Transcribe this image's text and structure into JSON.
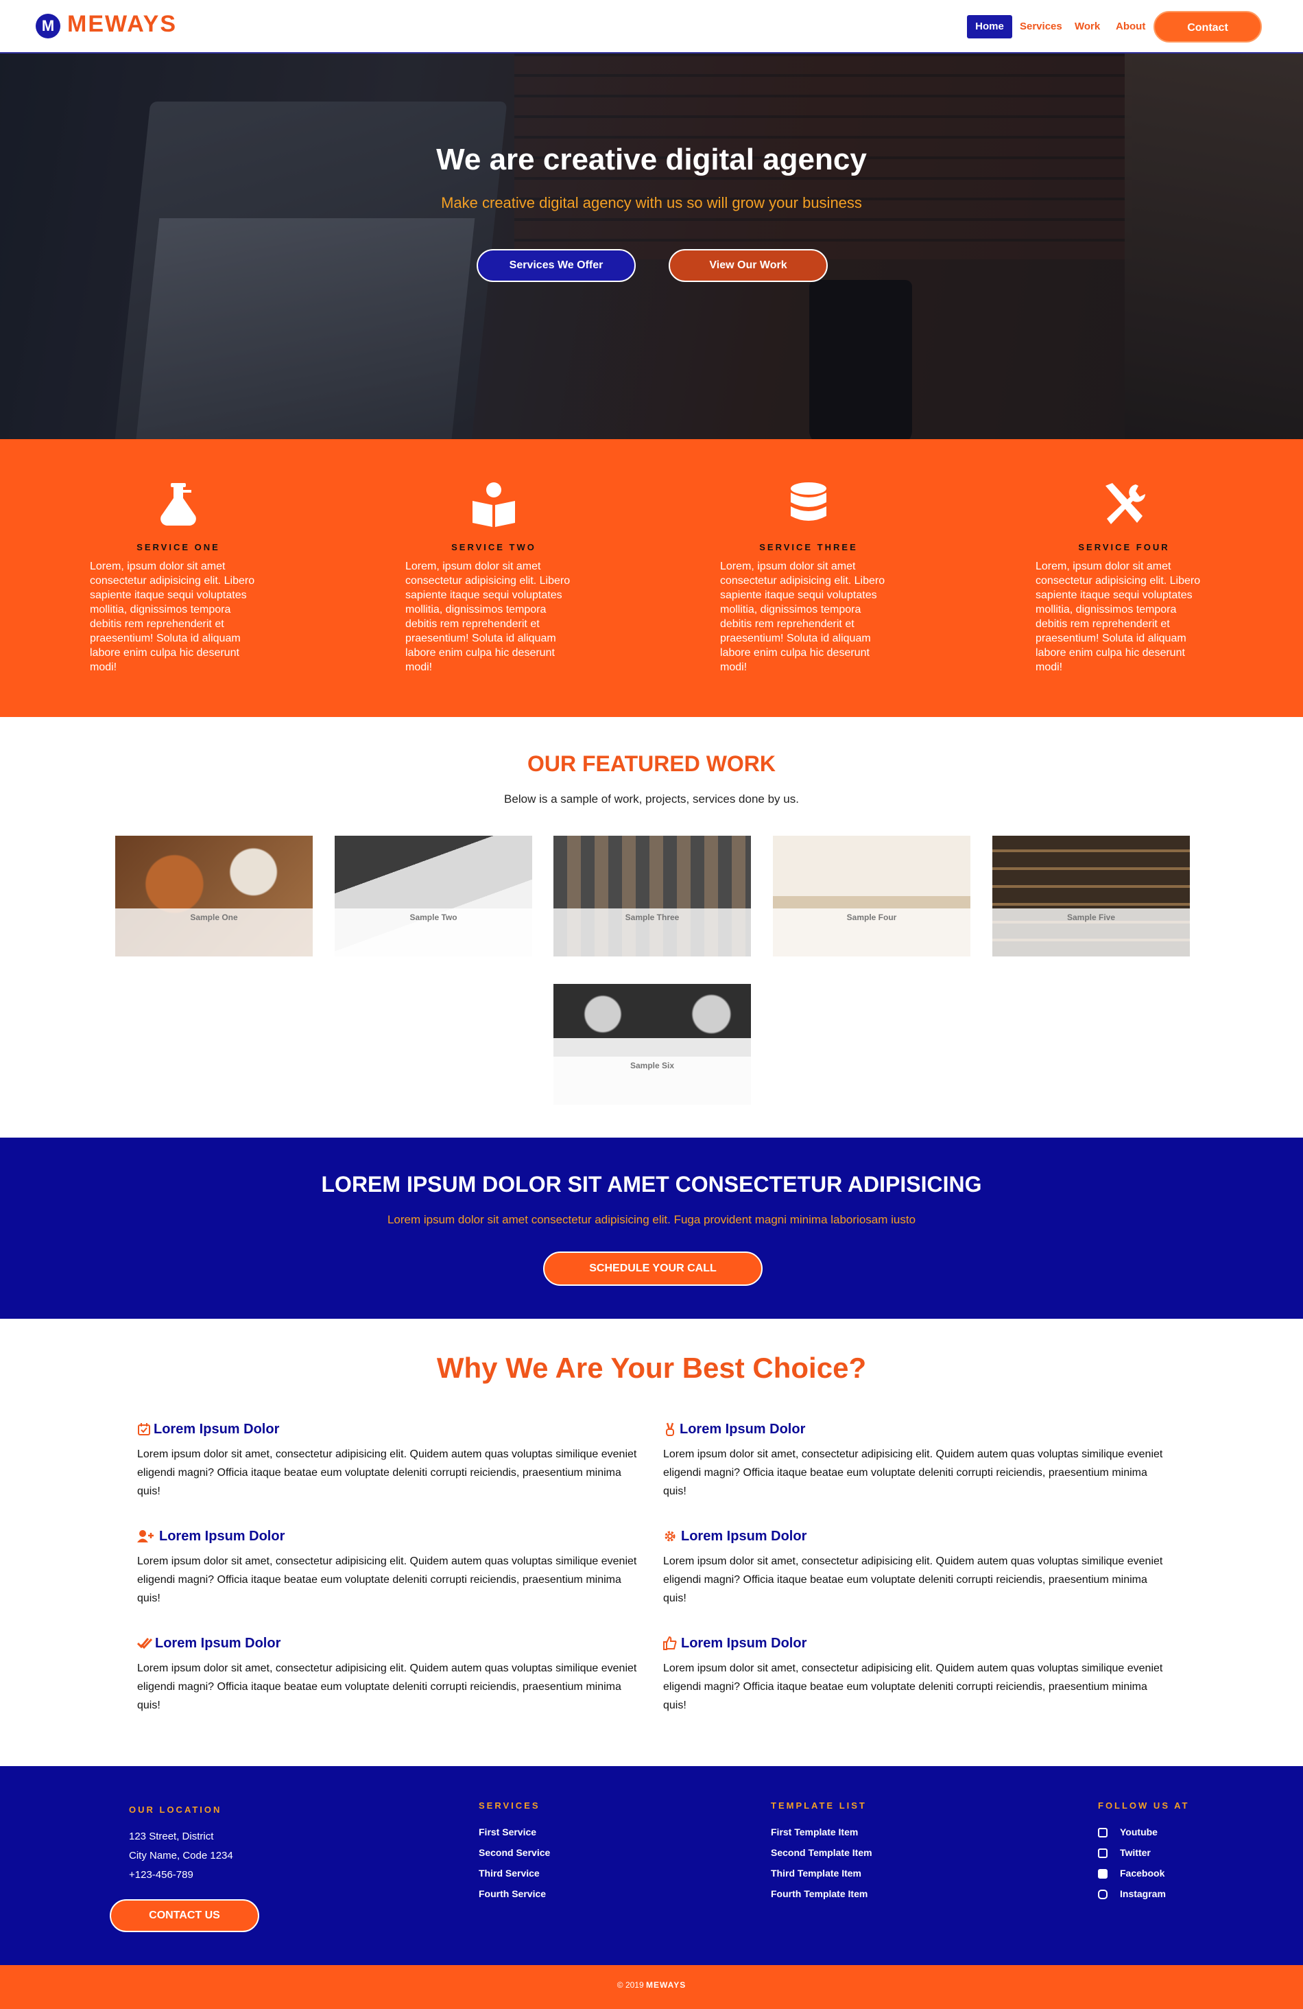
{
  "brand": {
    "name": "MEWAYS",
    "mark": "M"
  },
  "nav": {
    "home": "Home",
    "services": "Services",
    "work": "Work",
    "about": "About",
    "contact": "Contact"
  },
  "hero": {
    "title": "We are creative digital agency",
    "subtitle": "Make creative digital agency with us so will grow your business",
    "btn_services": "Services We Offer",
    "btn_work": "View Our Work"
  },
  "services": [
    {
      "title": "SERVICE ONE",
      "text": "Lorem, ipsum dolor sit amet consectetur adipisicing elit. Libero sapiente itaque sequi voluptates mollitia, dignissimos tempora debitis rem reprehenderit et praesentium! Soluta id aliquam labore enim culpa hic deserunt modi!",
      "icon": "flask-icon"
    },
    {
      "title": "SERVICE TWO",
      "text": "Lorem, ipsum dolor sit amet consectetur adipisicing elit. Libero sapiente itaque sequi voluptates mollitia, dignissimos tempora debitis rem reprehenderit et praesentium! Soluta id aliquam labore enim culpa hic deserunt modi!",
      "icon": "book-reader-icon"
    },
    {
      "title": "SERVICE THREE",
      "text": "Lorem, ipsum dolor sit amet consectetur adipisicing elit. Libero sapiente itaque sequi voluptates mollitia, dignissimos tempora debitis rem reprehenderit et praesentium! Soluta id aliquam labore enim culpa hic deserunt modi!",
      "icon": "database-icon"
    },
    {
      "title": "SERVICE FOUR",
      "text": "Lorem, ipsum dolor sit amet consectetur adipisicing elit. Libero sapiente itaque sequi voluptates mollitia, dignissimos tempora debitis rem reprehenderit et praesentium! Soluta id aliquam labore enim culpa hic deserunt modi!",
      "icon": "tools-icon"
    }
  ],
  "featured": {
    "title": "OUR FEATURED WORK",
    "subtitle": "Below is a sample of work, projects, services done by us.",
    "items": [
      "Sample One",
      "Sample Two",
      "Sample Three",
      "Sample Four",
      "Sample Five",
      "Sample Six"
    ]
  },
  "cta": {
    "title": "LOREM IPSUM DOLOR SIT AMET CONSECTETUR ADIPISICING",
    "subtitle": "Lorem ipsum dolor sit amet consectetur adipisicing elit. Fuga provident magni minima laboriosam iusto",
    "button": "SCHEDULE YOUR CALL"
  },
  "why": {
    "title": "Why We Are Your Best Choice?",
    "items": [
      {
        "heading": "Lorem Ipsum Dolor",
        "icon": "calendar-check-icon",
        "text": "Lorem ipsum dolor sit amet, consectetur adipisicing elit. Quidem autem quas voluptas similique eveniet eligendi magni? Officia itaque beatae eum voluptate deleniti corrupti reiciendis, praesentium minima quis!"
      },
      {
        "heading": "Lorem Ipsum Dolor",
        "icon": "victory-hand-icon",
        "text": "Lorem ipsum dolor sit amet, consectetur adipisicing elit. Quidem autem quas voluptas similique eveniet eligendi magni? Officia itaque beatae eum voluptate deleniti corrupti reiciendis, praesentium minima quis!"
      },
      {
        "heading": "Lorem Ipsum Dolor",
        "icon": "user-plus-icon",
        "text": "Lorem ipsum dolor sit amet, consectetur adipisicing elit. Quidem autem quas voluptas similique eveniet eligendi magni? Officia itaque beatae eum voluptate deleniti corrupti reiciendis, praesentium minima quis!"
      },
      {
        "heading": "Lorem Ipsum Dolor",
        "icon": "cog-icon",
        "text": "Lorem ipsum dolor sit amet, consectetur adipisicing elit. Quidem autem quas voluptas similique eveniet eligendi magni? Officia itaque beatae eum voluptate deleniti corrupti reiciendis, praesentium minima quis!"
      },
      {
        "heading": "Lorem Ipsum Dolor",
        "icon": "double-check-icon",
        "text": "Lorem ipsum dolor sit amet, consectetur adipisicing elit. Quidem autem quas voluptas similique eveniet eligendi magni? Officia itaque beatae eum voluptate deleniti corrupti reiciendis, praesentium minima quis!"
      },
      {
        "heading": "Lorem Ipsum Dolor",
        "icon": "thumbs-up-icon",
        "text": "Lorem ipsum dolor sit amet, consectetur adipisicing elit. Quidem autem quas voluptas similique eveniet eligendi magni? Officia itaque beatae eum voluptate deleniti corrupti reiciendis, praesentium minima quis!"
      }
    ]
  },
  "footer": {
    "location_heading": "OUR LOCATION",
    "address1": "123 Street, District",
    "address2": "City Name, Code 1234",
    "phone": "+123-456-789",
    "contact_button": "CONTACT US",
    "services_heading": "SERVICES",
    "services": [
      "First Service",
      "Second Service",
      "Third Service",
      "Fourth Service"
    ],
    "templates_heading": "TEMPLATE LIST",
    "templates": [
      "First Template Item",
      "Second Template Item",
      "Third Template Item",
      "Fourth Template Item"
    ],
    "follow_heading": "FOLLOW US AT",
    "social": [
      "Youtube",
      "Twitter",
      "Facebook",
      "Instagram"
    ],
    "copyright": "© 2019",
    "copyright_brand": "MEWAYS"
  },
  "colors": {
    "orange": "#ff5a1a",
    "navy": "#0a0a96",
    "accent": "#f4a024"
  }
}
